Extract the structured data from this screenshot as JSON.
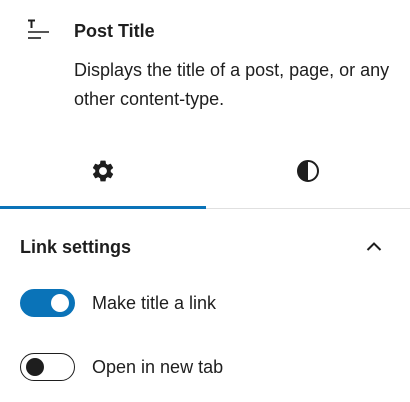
{
  "block_card": {
    "icon": "post-title-icon",
    "title": "Post Title",
    "description": "Displays the title of a post, page, or any other content-type."
  },
  "tabs": [
    {
      "icon": "gear-icon",
      "selected": true
    },
    {
      "icon": "contrast-icon",
      "selected": false
    }
  ],
  "link_settings": {
    "title": "Link settings",
    "expanded": true,
    "toggles": [
      {
        "label": "Make title a link",
        "checked": true
      },
      {
        "label": "Open in new tab",
        "checked": false
      }
    ]
  },
  "colors": {
    "accent": "#0a73b8",
    "text": "#1e1e1e",
    "divider": "#e0e0e0"
  }
}
